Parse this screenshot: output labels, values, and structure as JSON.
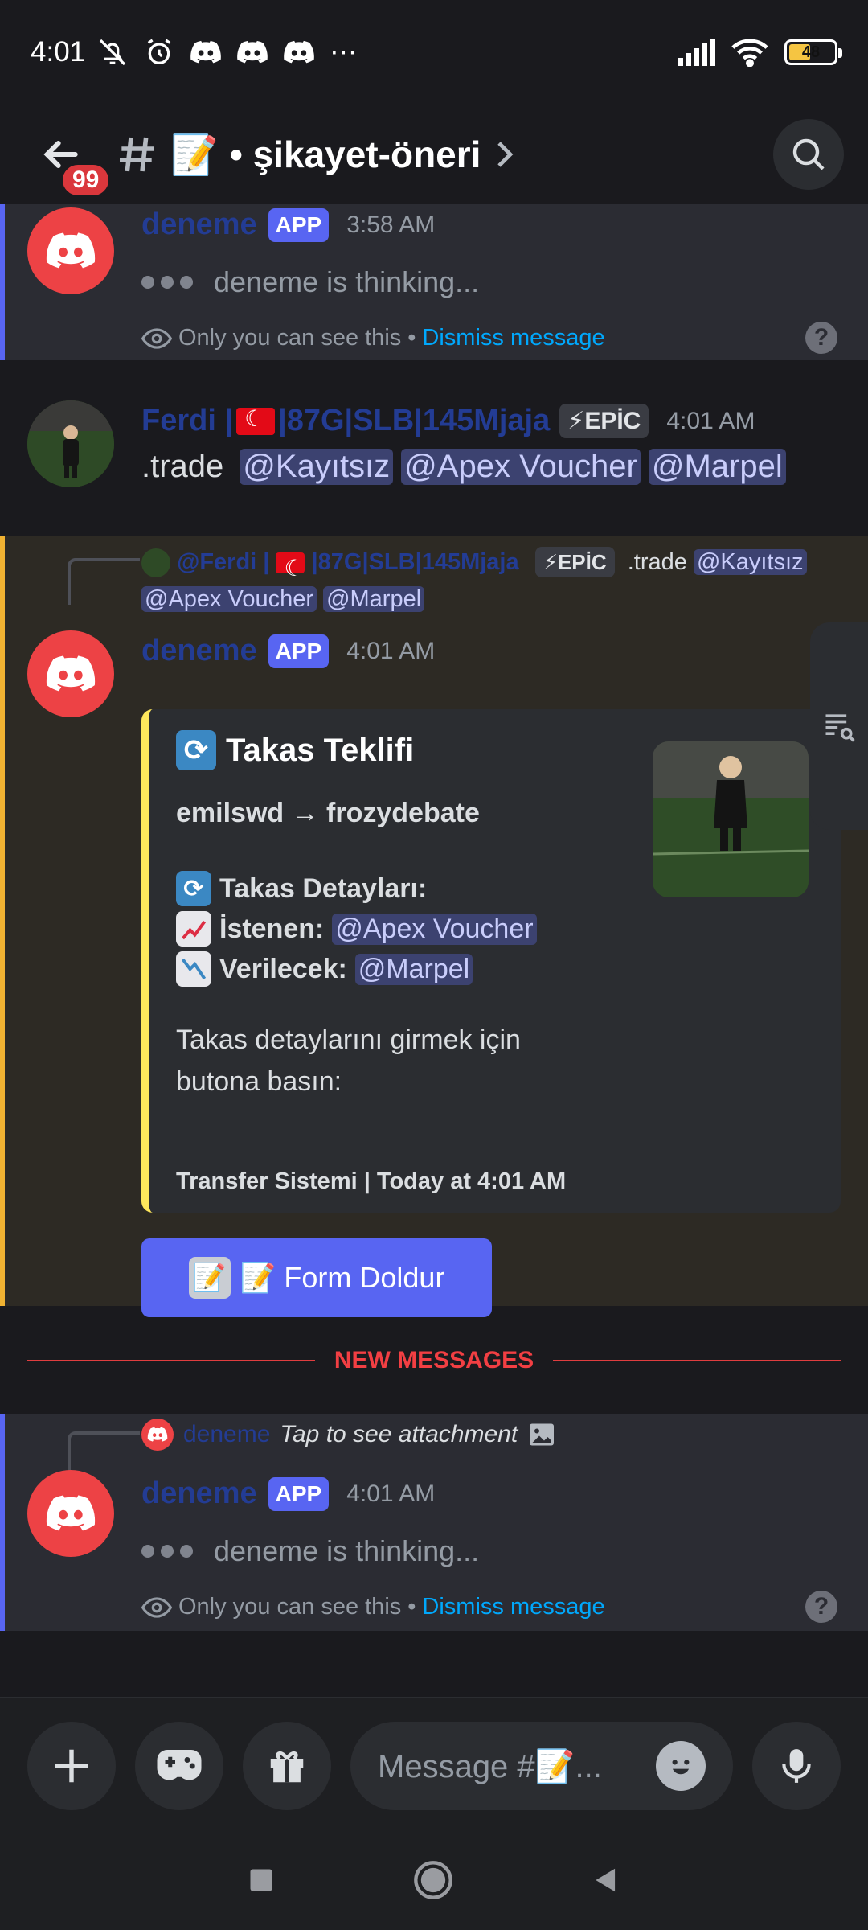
{
  "status_bar": {
    "time": "4:01",
    "more": "⋯",
    "battery": "48"
  },
  "header": {
    "unread_badge": "99",
    "channel_name": "• şikayet-öneri"
  },
  "messages": [
    {
      "author": "deneme",
      "app_tag": "APP",
      "time": "3:58 AM",
      "thinking": "deneme is thinking...",
      "only_you": "Only you can see this",
      "dismiss": "Dismiss message"
    },
    {
      "author": "Ferdi |",
      "author_rest": "|87G|SLB|145Mjaja",
      "badge": "⚡EPİC",
      "time": "4:01 AM",
      "text": ".trade",
      "mentions": [
        "@Kayıtsız",
        "@Apex Voucher",
        "@Marpel"
      ]
    },
    {
      "reply": {
        "author": "@Ferdi |",
        "author_rest": "|87G|SLB|145Mjaja",
        "badge": "⚡EPİC",
        "text": ".trade",
        "mentions": [
          "@Kayıtsız",
          "@Apex Voucher",
          "@Marpel"
        ]
      },
      "author": "deneme",
      "app_tag": "APP",
      "time": "4:01 AM",
      "embed": {
        "title": "Takas Teklifi",
        "users": "emilswd → frozydebate",
        "details_title": "Takas Detayları:",
        "wanted_label": "İstenen:",
        "wanted_mention": "@Apex Voucher",
        "given_label": "Verilecek:",
        "given_mention": "@Marpel",
        "instruction": "Takas detaylarını girmek için butona basın:",
        "footer": "Transfer Sistemi | Today at 4:01 AM"
      },
      "button_label": "📝 Form Doldur"
    },
    {
      "reply": {
        "author": "deneme",
        "text": "Tap to see attachment"
      },
      "author": "deneme",
      "app_tag": "APP",
      "time": "4:01 AM",
      "thinking": "deneme is thinking...",
      "only_you": "Only you can see this",
      "dismiss": "Dismiss message"
    }
  ],
  "divider_label": "NEW MESSAGES",
  "composer": {
    "placeholder": "Message #📝..."
  },
  "colors": {
    "blurple": "#5865f2",
    "discord_red": "#ed4245",
    "link": "#00a8fc",
    "embed_accent": "#fee75c"
  }
}
